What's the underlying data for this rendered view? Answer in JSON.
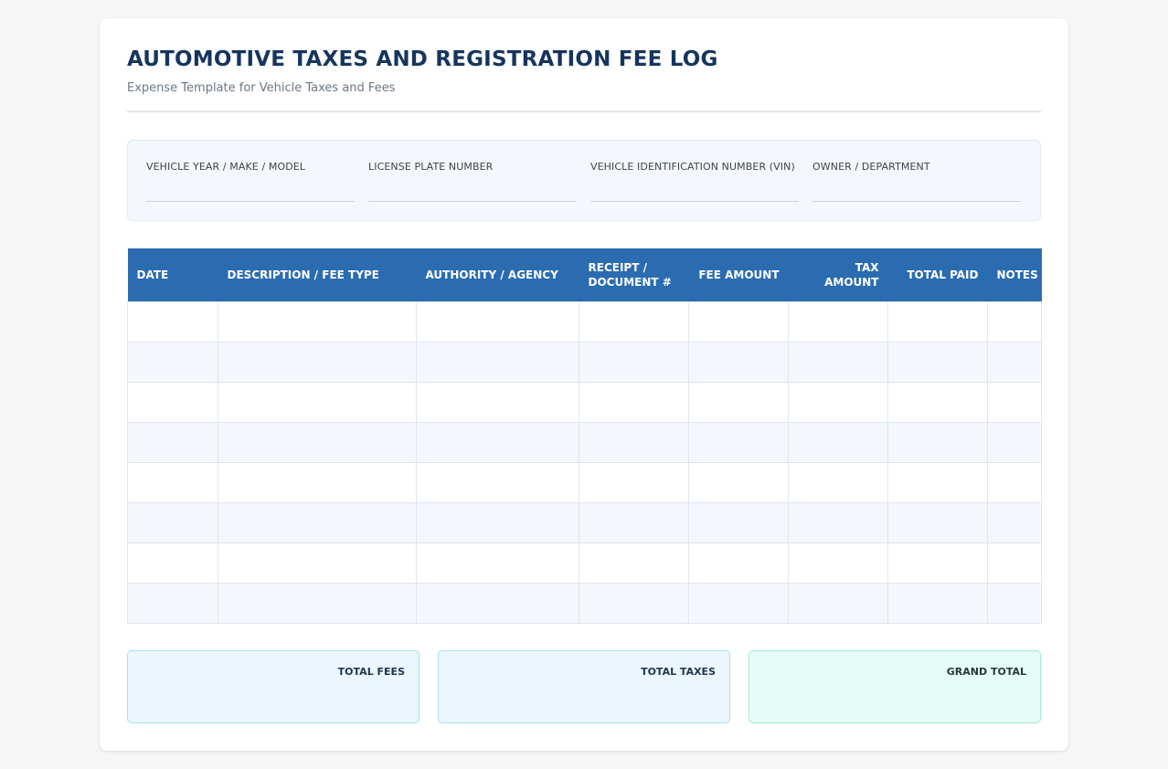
{
  "header": {
    "title": "AUTOMOTIVE TAXES AND REGISTRATION FEE LOG",
    "subtitle": "Expense Template for Vehicle Taxes and Fees"
  },
  "vehicle_info": {
    "fields": [
      {
        "label": "VEHICLE YEAR / MAKE / MODEL",
        "value": ""
      },
      {
        "label": "LICENSE PLATE NUMBER",
        "value": ""
      },
      {
        "label": "VEHICLE IDENTIFICATION NUMBER (VIN)",
        "value": ""
      },
      {
        "label": "OWNER / DEPARTMENT",
        "value": ""
      }
    ]
  },
  "table": {
    "columns": [
      "DATE",
      "DESCRIPTION / FEE TYPE",
      "AUTHORITY / AGENCY",
      "RECEIPT / DOCUMENT #",
      "FEE AMOUNT",
      "TAX AMOUNT",
      "TOTAL PAID",
      "NOTES"
    ],
    "rows": [
      [
        "",
        "",
        "",
        "",
        "",
        "",
        "",
        ""
      ],
      [
        "",
        "",
        "",
        "",
        "",
        "",
        "",
        ""
      ],
      [
        "",
        "",
        "",
        "",
        "",
        "",
        "",
        ""
      ],
      [
        "",
        "",
        "",
        "",
        "",
        "",
        "",
        ""
      ],
      [
        "",
        "",
        "",
        "",
        "",
        "",
        "",
        ""
      ],
      [
        "",
        "",
        "",
        "",
        "",
        "",
        "",
        ""
      ],
      [
        "",
        "",
        "",
        "",
        "",
        "",
        "",
        ""
      ],
      [
        "",
        "",
        "",
        "",
        "",
        "",
        "",
        ""
      ]
    ]
  },
  "totals": {
    "fees_label": "TOTAL FEES",
    "taxes_label": "TOTAL TAXES",
    "grand_label": "GRAND TOTAL"
  },
  "colors": {
    "title": "#16355e",
    "header_bg": "#2b6cb0",
    "accent_blue_box": "#ebf6fd",
    "accent_green_box": "#e5fcf7"
  }
}
